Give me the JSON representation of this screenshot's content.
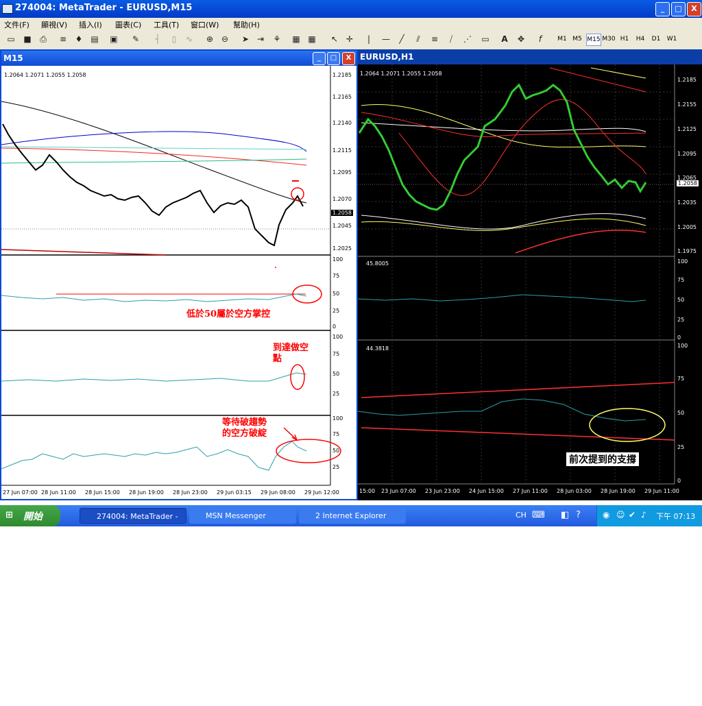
{
  "window": {
    "title": "274004: MetaTrader - EURUSD,M15",
    "min": "_",
    "max": "□",
    "close": "X"
  },
  "menu": [
    "文件(F)",
    "顯視(V)",
    "插入(I)",
    "圖表(C)",
    "工具(T)",
    "窗口(W)",
    "幫助(H)"
  ],
  "timeframes": [
    "M1",
    "M5",
    "M15",
    "M30",
    "H1",
    "H4",
    "D1",
    "W1"
  ],
  "selected_timeframe": "M15",
  "left_chart": {
    "title": "M15",
    "ohlc": "1.2064 1.2071 1.2055 1.2058",
    "price_ticks": [
      "1.2185",
      "1.2165",
      "1.2140",
      "1.2115",
      "1.2095",
      "1.2070",
      "1.2045",
      "1.2025"
    ],
    "current_price": "1.2058",
    "time_ticks": [
      "27 Jun 07:00",
      "28 Jun 11:00",
      "28 Jun 15:00",
      "28 Jun 19:00",
      "28 Jun 23:00",
      "29 Jun 03:15",
      "29 Jun 08:00",
      "29 Jun 12:00"
    ],
    "indicator_ticks": [
      "100",
      "75",
      "50",
      "25",
      "0"
    ],
    "ann1": "低於50屬於空方掌控",
    "ann2_line1": "到達做空",
    "ann2_line2": "點",
    "ann3_line1": "等待破趨勢",
    "ann3_line2": "的空方破綻"
  },
  "right_chart": {
    "title": "EURUSD,H1",
    "ohlc": "1.2064 1.2071 1.2055 1.2058",
    "price_ticks": [
      "1.2185",
      "1.2155",
      "1.2125",
      "1.2095",
      "1.2065",
      "1.2035",
      "1.2005",
      "1.1975"
    ],
    "current_price": "1.2058",
    "ind1_value": "45.8005",
    "ind2_value": "44.3818",
    "time_ticks": [
      "15:00",
      "23 Jun 07:00",
      "23 Jun 23:00",
      "24 Jun 15:00",
      "27 Jun 11:00",
      "28 Jun 03:00",
      "28 Jun 19:00",
      "29 Jun 11:00"
    ],
    "ind2_ticks": [
      "100",
      "75",
      "50",
      "25",
      "0"
    ],
    "annotation": "前次提到的支撐"
  },
  "taskbar": {
    "start": "開始",
    "tasks": [
      "274004: MetaTrader - ...",
      "MSN Messenger",
      "2 Internet Explorer"
    ],
    "ime": "CH",
    "clock": "下午 07:13"
  }
}
